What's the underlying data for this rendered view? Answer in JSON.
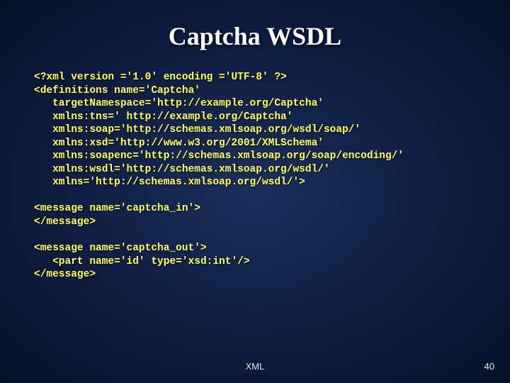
{
  "slide": {
    "title": "Captcha WSDL",
    "code": "<?xml version ='1.0' encoding ='UTF-8' ?>\n<definitions name='Captcha'\n   targetNamespace='http://example.org/Captcha'\n   xmlns:tns=' http://example.org/Captcha'\n   xmlns:soap='http://schemas.xmlsoap.org/wsdl/soap/'\n   xmlns:xsd='http://www.w3.org/2001/XMLSchema'\n   xmlns:soapenc='http://schemas.xmlsoap.org/soap/encoding/'\n   xmlns:wsdl='http://schemas.xmlsoap.org/wsdl/'\n   xmlns='http://schemas.xmlsoap.org/wsdl/'>\n\n<message name='captcha_in'>\n</message>\n\n<message name='captcha_out'>\n   <part name='id' type='xsd:int'/>\n</message>",
    "footer_label": "XML",
    "footer_number": "40"
  }
}
